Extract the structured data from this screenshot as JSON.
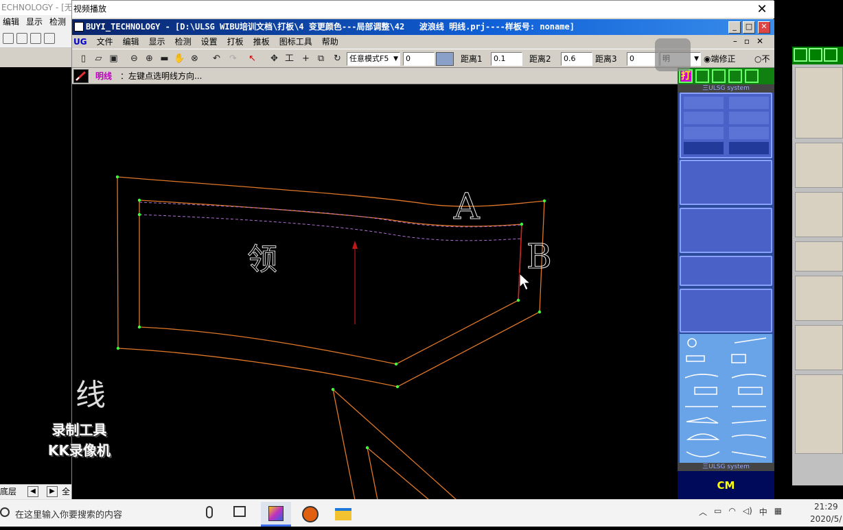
{
  "background_app": {
    "title": "ECHNOLOGY - [无",
    "menu": [
      "编辑",
      "显示",
      "检测"
    ],
    "status_left": "底层",
    "status_right": "全"
  },
  "outer_window": {
    "title": "视频播放",
    "close_glyph": "✕"
  },
  "inner_window": {
    "title": "BUYI_TECHNOLOGY - [D:\\ULSG WIBU培训文档\\打板\\4 变更颜色---局部调整\\42   波浪线 明线.prj----样板号: noname]",
    "min_glyph": "_",
    "max_glyph": "□",
    "close_glyph": "✕"
  },
  "menubar": {
    "logo": "UG",
    "items": [
      "文件",
      "编辑",
      "显示",
      "检测",
      "设置",
      "打板",
      "推板",
      "图标工具",
      "帮助"
    ]
  },
  "toolbar": {
    "mode_select": "任意模式F5",
    "value_field": "0",
    "dist1_label": "距离1",
    "dist1_value": "0.1",
    "dist2_label": "距离2",
    "dist2_value": "0.6",
    "dist3_label": "距离3",
    "dist3_value": "0",
    "select2_value": "明",
    "radio1_label": "端修正",
    "radio2_label": "不"
  },
  "hint": {
    "label": "明线",
    "text": "：左键点选明线方向..."
  },
  "canvas": {
    "piece_label": "领",
    "point_a": "A",
    "point_b": "B",
    "overlay_label": "线"
  },
  "watermark": {
    "line1": "录制工具",
    "line2": "KK录像机"
  },
  "palette": {
    "tab_glyph": "打",
    "system_label_top": "三ULSG system",
    "system_label_bottom": "三ULSG system",
    "bottom_button": "CM"
  },
  "taskbar": {
    "search_placeholder": "在这里输入你要搜索的内容",
    "tray_ime": "中",
    "clock_time": "21:29",
    "clock_date": "2020/5/"
  },
  "colors": {
    "outline": "#e07828",
    "inner_line": "#30c050",
    "dashed_line": "#b070d8",
    "grainline": "#c01818",
    "point": "#40ff40",
    "title_bar": "#0a246a"
  }
}
